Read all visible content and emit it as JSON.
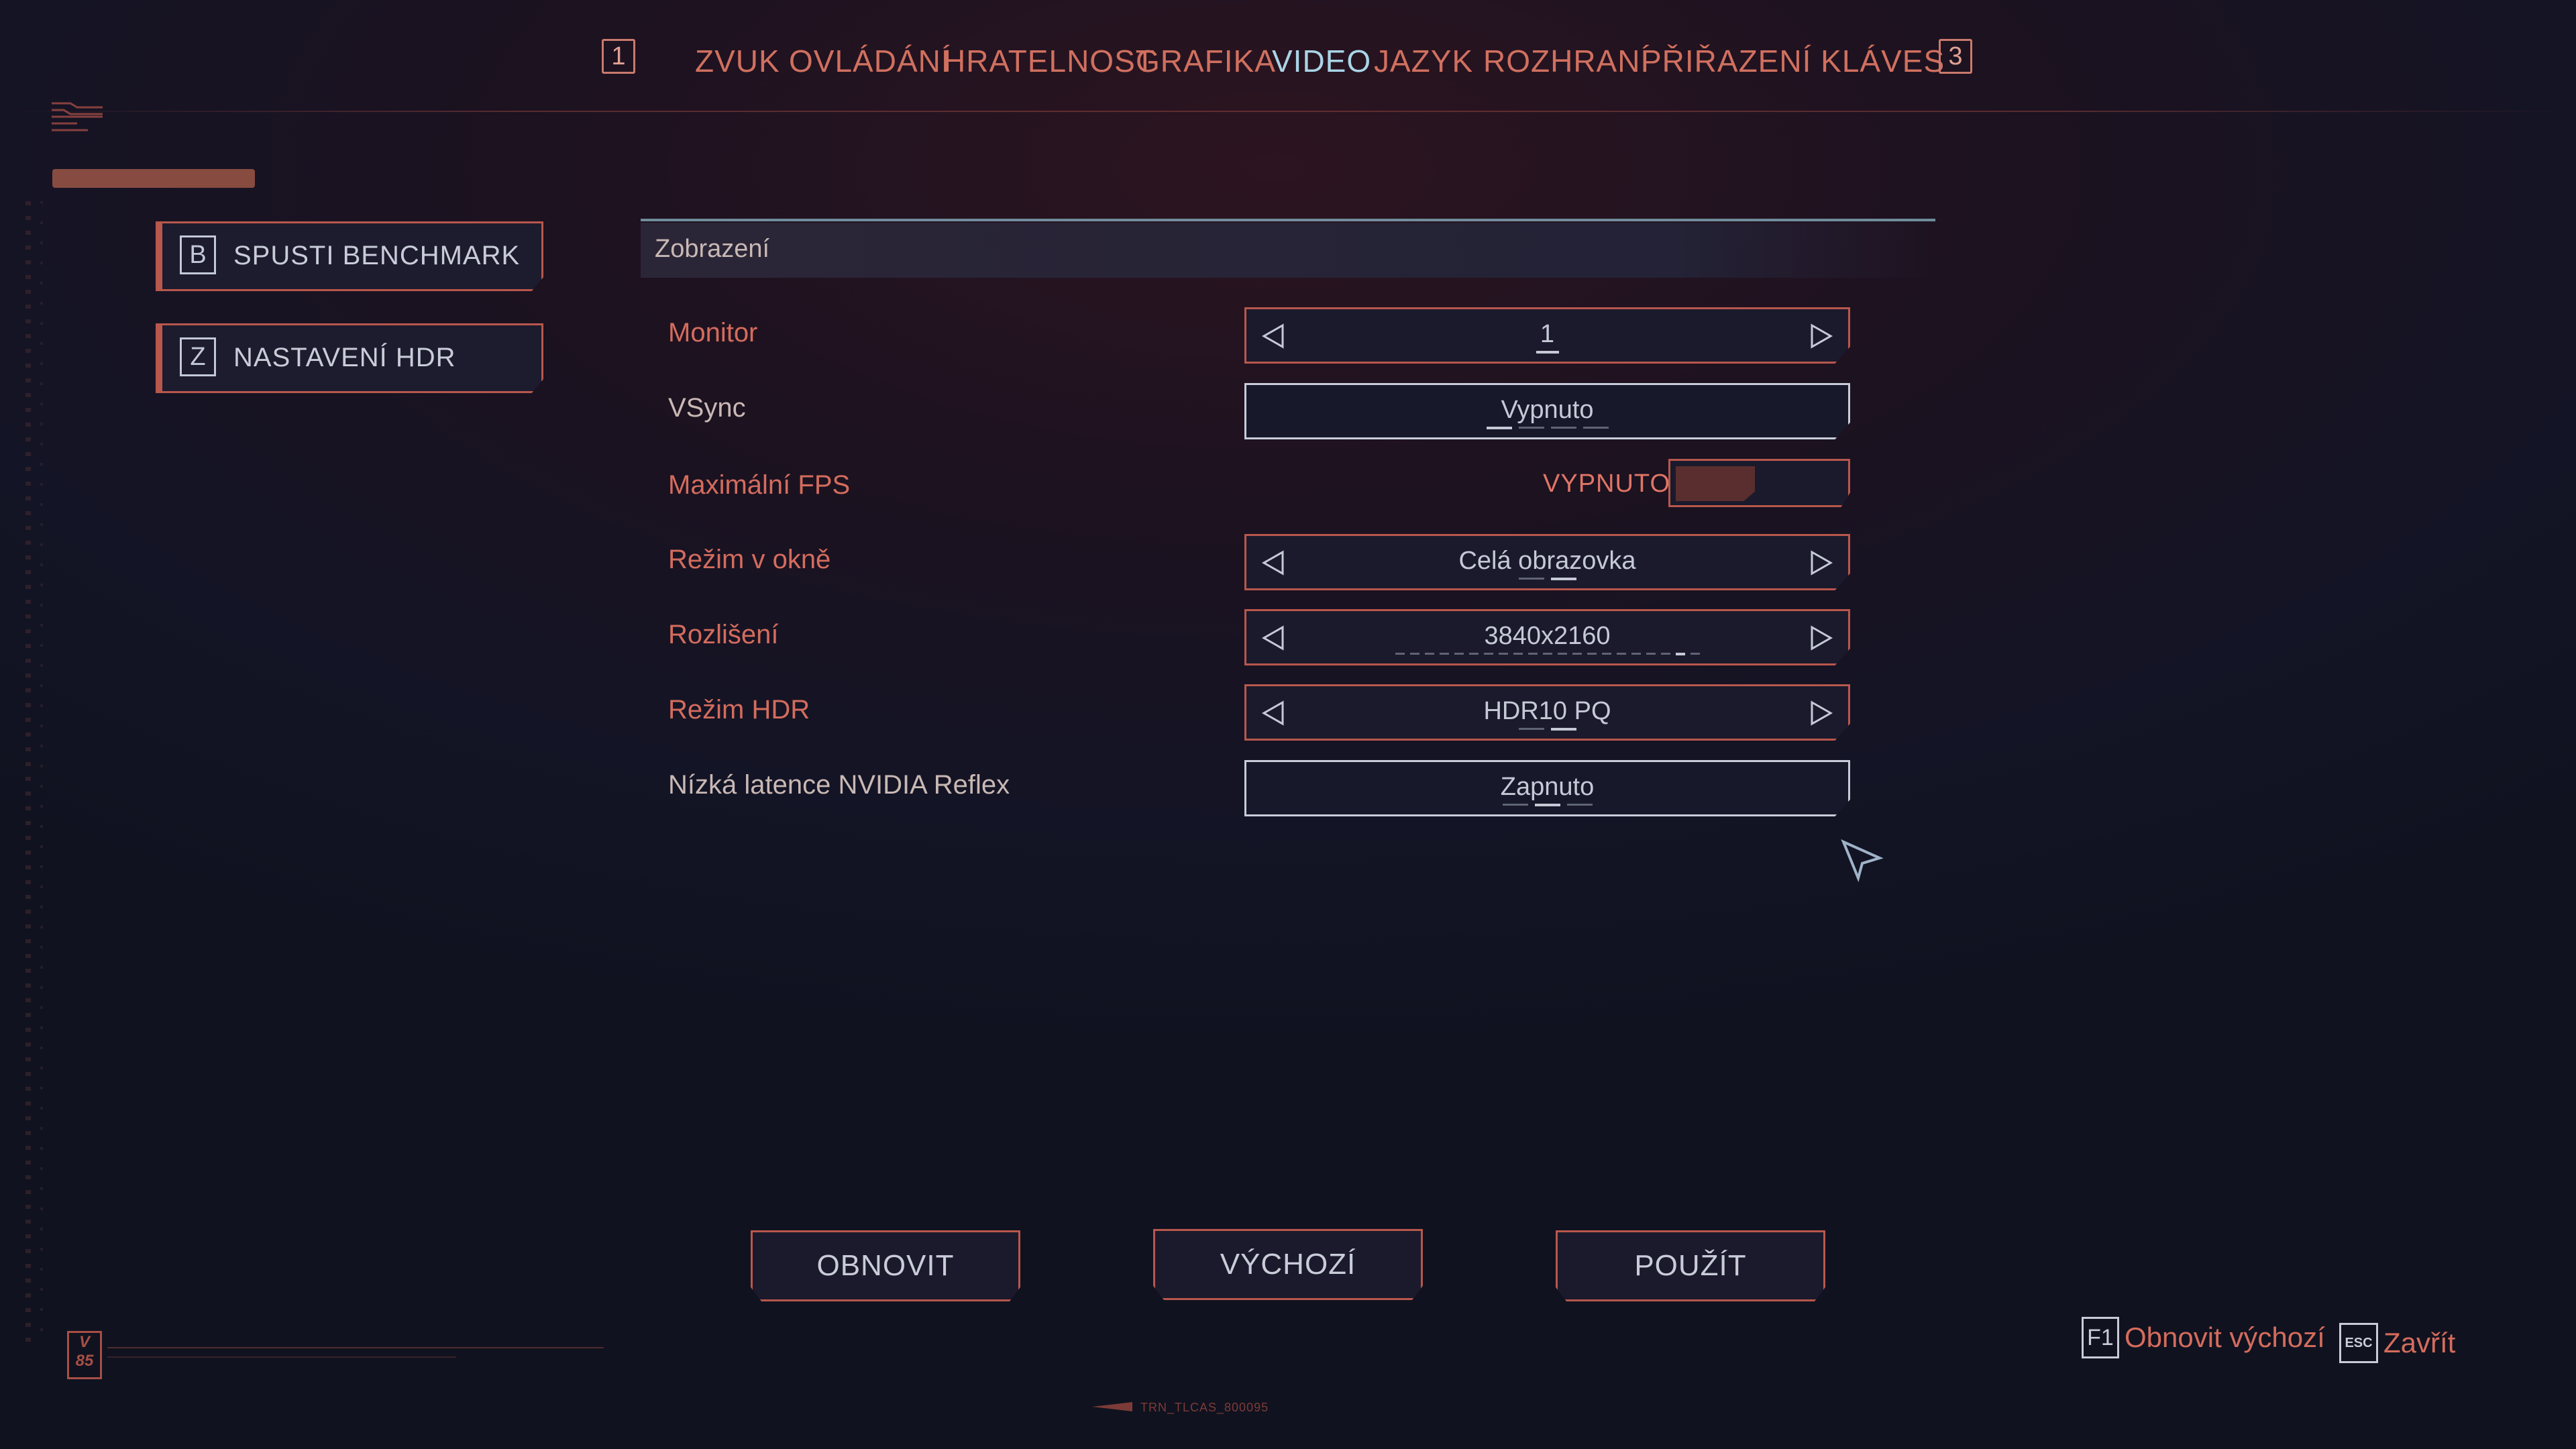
{
  "tabs": {
    "prev_key": "1",
    "next_key": "3",
    "items": [
      {
        "label": "ZVUK"
      },
      {
        "label": "OVLÁDÁNÍ"
      },
      {
        "label": "HRATELNOST"
      },
      {
        "label": "GRAFIKA"
      },
      {
        "label": "VIDEO"
      },
      {
        "label": "JAZYK"
      },
      {
        "label": "ROZHRANÍ"
      },
      {
        "label": "PŘIŘAZENÍ KLÁVES"
      }
    ],
    "active": "VIDEO"
  },
  "side_buttons": [
    {
      "key": "B",
      "label": "SPUSTI BENCHMARK"
    },
    {
      "key": "Z",
      "label": "NASTAVENÍ HDR"
    }
  ],
  "section": {
    "title": "Zobrazení"
  },
  "settings": [
    {
      "label": "Monitor",
      "value": "1"
    },
    {
      "label": "VSync",
      "value": "Vypnuto"
    },
    {
      "label": "Maximální FPS",
      "value": "VYPNUTO"
    },
    {
      "label": "Režim v okně",
      "value": "Celá obrazovka"
    },
    {
      "label": "Rozlišení",
      "value": "3840x2160"
    },
    {
      "label": "Režim HDR",
      "value": "HDR10 PQ"
    },
    {
      "label": "Nízká latence NVIDIA Reflex",
      "value": "Zapnuto"
    }
  ],
  "bottom_buttons": {
    "refresh": "OBNOVIT",
    "default": "VÝCHOZÍ",
    "apply": "POUŽÍT"
  },
  "hints": {
    "restore_key": "F1",
    "restore_label": "Obnovit výchozí",
    "close_key": "ESC",
    "close_label": "Zavřít"
  },
  "deco": {
    "version_badge": "V 85",
    "footer_code": "TRN_TLCAS_800095"
  },
  "colors": {
    "accent_red": "#d46c5d",
    "active_tab": "#a9d4e6",
    "border_red": "#b8574c"
  }
}
